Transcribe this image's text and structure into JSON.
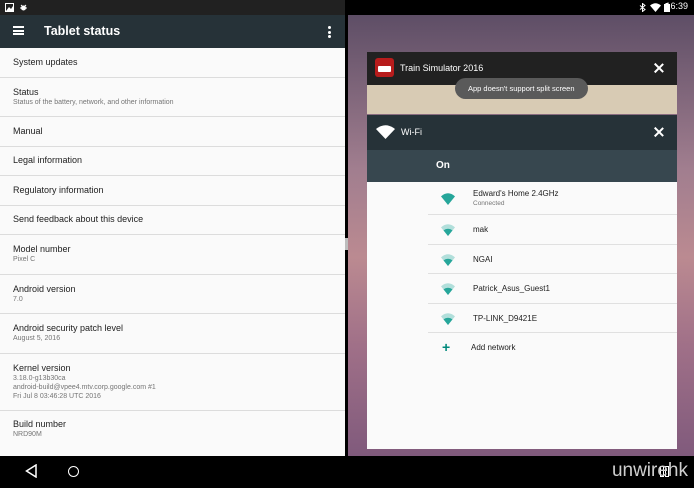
{
  "status_bar": {
    "time": "16:39"
  },
  "toolbar": {
    "title": "Tablet status"
  },
  "settings": [
    {
      "title": "System updates",
      "subtitle": ""
    },
    {
      "title": "Status",
      "subtitle": "Status of the battery, network, and other information"
    },
    {
      "title": "Manual",
      "subtitle": ""
    },
    {
      "title": "Legal information",
      "subtitle": ""
    },
    {
      "title": "Regulatory information",
      "subtitle": ""
    },
    {
      "title": "Send feedback about this device",
      "subtitle": ""
    },
    {
      "title": "Model number",
      "subtitle": "Pixel C"
    },
    {
      "title": "Android version",
      "subtitle": "7.0"
    },
    {
      "title": "Android security patch level",
      "subtitle": "August 5, 2016"
    },
    {
      "title": "Kernel version",
      "subtitle_lines": [
        "3.18.0-g13b30ca",
        "android-build@vpee4.mtv.corp.google.com #1",
        "Fri Jul 8 03:46:28 UTC 2016"
      ]
    },
    {
      "title": "Build number",
      "subtitle": "NRD90M"
    }
  ],
  "recent_app": {
    "title": "Train Simulator 2016",
    "toast": "App doesn't support split screen"
  },
  "wifi_panel": {
    "title": "Wi-Fi",
    "state": "On",
    "accent": "#26a69a",
    "networks": [
      {
        "name": "Edward's Home 2.4GHz",
        "status": "Connected"
      },
      {
        "name": "mak",
        "status": ""
      },
      {
        "name": "NGAI",
        "status": ""
      },
      {
        "name": "Patrick_Asus_Guest1",
        "status": ""
      },
      {
        "name": "TP-LINK_D9421E",
        "status": ""
      }
    ],
    "add_network": "Add network"
  },
  "watermark": "unwirehk"
}
